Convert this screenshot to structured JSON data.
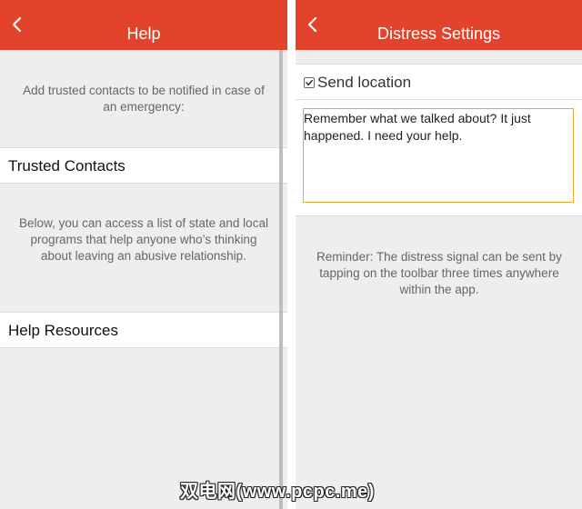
{
  "colors": {
    "appbar": "#e2432a",
    "background": "#eeeeee",
    "row": "#ffffff",
    "text_field_border": "#f0a62e"
  },
  "help_screen": {
    "title": "Help",
    "back_icon": "chevron-left-icon",
    "intro_text": "Add trusted contacts to be notified in case of an emergency:",
    "trusted_contacts_label": "Trusted Contacts",
    "resources_text": "Below, you can access a list of state and local programs that help anyone who’s thinking about leaving an abusive relationship.",
    "help_resources_label": "Help Resources"
  },
  "distress_screen": {
    "title": "Distress Settings",
    "back_icon": "chevron-left-icon",
    "send_location_label": "Send location",
    "send_location_checked": true,
    "message_value": "Remember what we talked about? It just happened. I need your help.",
    "reminder_text": "Reminder: The distress signal can be sent by tapping on the toolbar three times anywhere within the app."
  },
  "watermark": "双电网(www.pcpc.me)"
}
